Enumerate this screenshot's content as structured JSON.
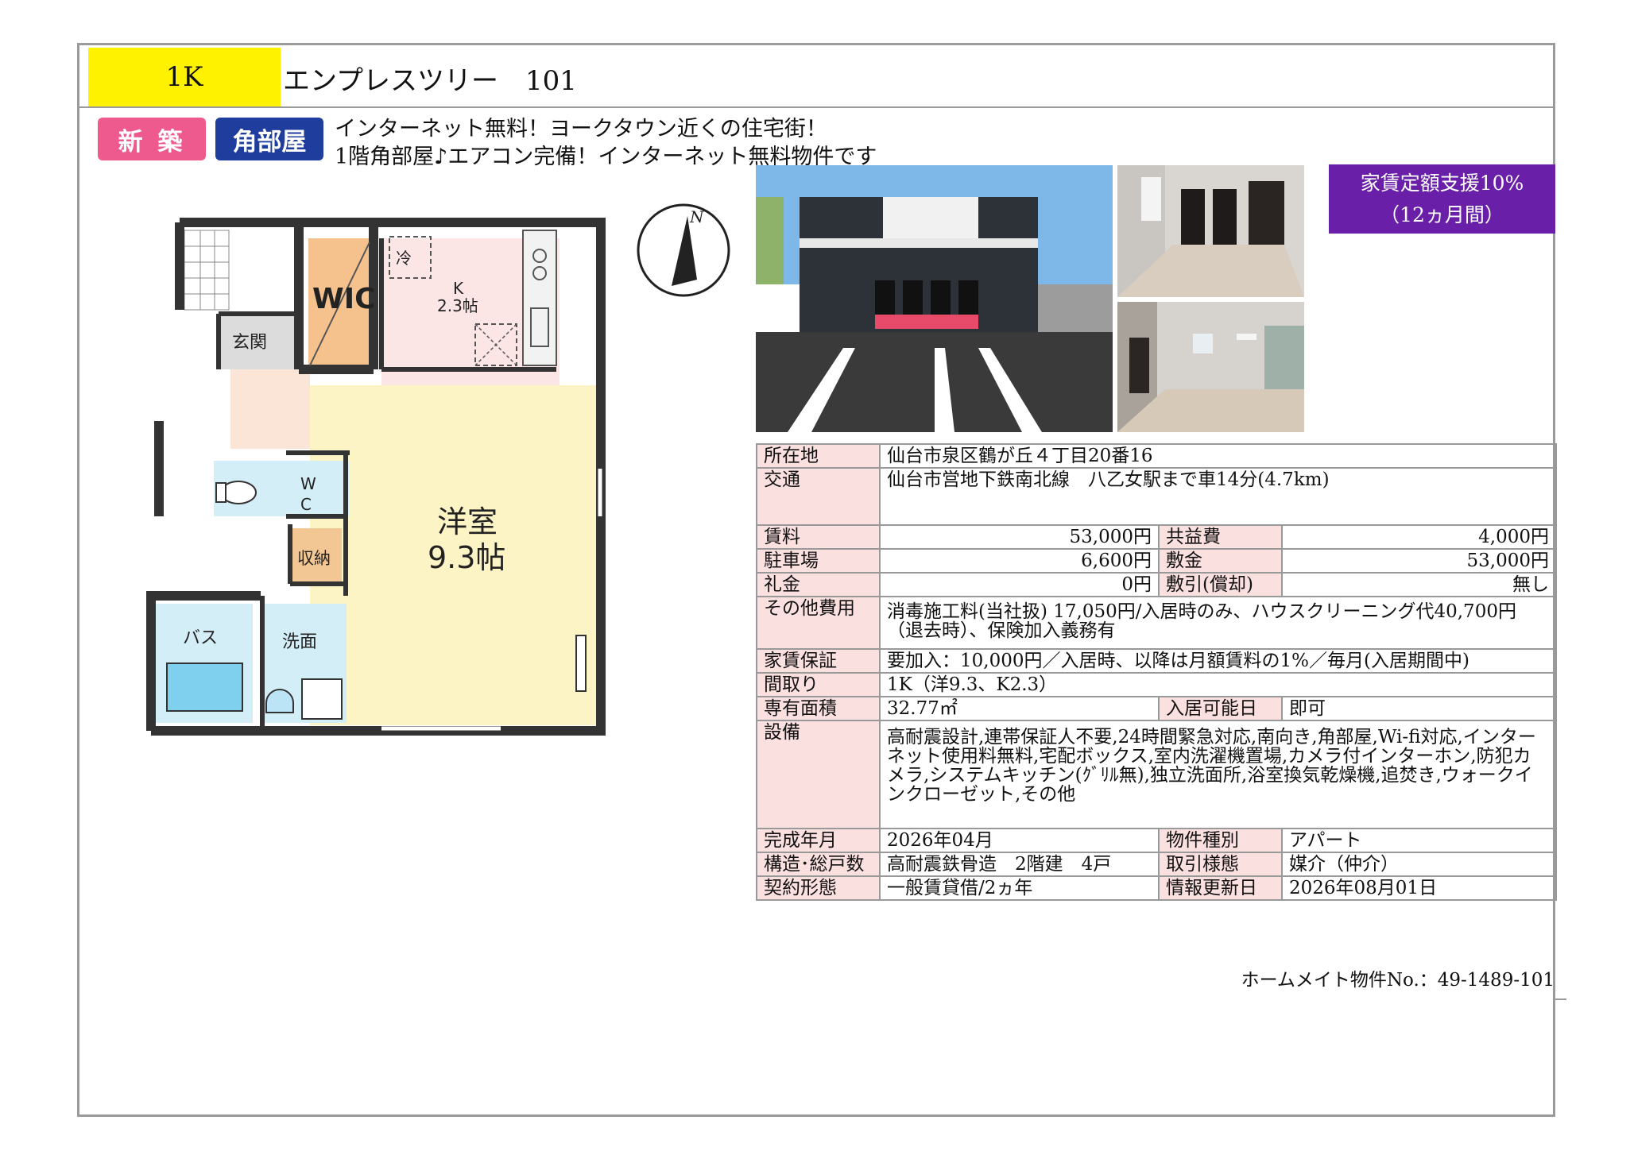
{
  "header": {
    "layout_type": "1K",
    "property_name": "エンプレスツリー　101"
  },
  "badges": {
    "new": "新 築",
    "corner": "角部屋"
  },
  "catchcopy": {
    "line1": "インターネット無料！ヨークタウン近くの住宅街！",
    "line2": "1階角部屋♪エアコン完備！インターネット無料物件です"
  },
  "rent_support": {
    "line1": "家賃定額支援10%",
    "line2": "（12ヵ月間）"
  },
  "floorplan": {
    "wic": "WIC",
    "entrance": "玄関",
    "kitchen_ref": "冷",
    "kitchen_name": "K",
    "kitchen_size": "2.3帖",
    "wc_w": "W",
    "wc_c": "C",
    "storage": "収納",
    "room_name": "洋室",
    "room_size": "9.3帖",
    "bath": "バス",
    "washroom": "洗面",
    "north": "N"
  },
  "specs": {
    "address_label": "所在地",
    "address": "仙台市泉区鶴が丘４丁目20番16",
    "transport_label": "交通",
    "transport": "仙台市営地下鉄南北線　八乙女駅まで車14分(4.7km)",
    "rent_label": "賃料",
    "rent": "53,000円",
    "common_label": "共益費",
    "common": "4,000円",
    "parking_label": "駐車場",
    "parking": "6,600円",
    "deposit_label": "敷金",
    "deposit": "53,000円",
    "key_money_label": "礼金",
    "key_money": "0円",
    "amortization_label": "敷引(償却)",
    "amortization": "無し",
    "other_label": "その他費用",
    "other": "消毒施工料(当社扱) 17,050円/入居時のみ、ハウスクリーニング代40,700円（退去時）、保険加入義務有",
    "guarantee_label": "家賃保証",
    "guarantee": "要加入：10,000円／入居時、以降は月額賃料の1%／毎月(入居期間中)",
    "layout_label": "間取り",
    "layout": "1K（洋9.3、K2.3）",
    "area_label": "専有面積",
    "area": "32.77㎡",
    "move_in_label": "入居可能日",
    "move_in": "即可",
    "facilities_label": "設備",
    "facilities": "高耐震設計,連帯保証人不要,24時間緊急対応,南向き,角部屋,Wi-fi対応,インターネット使用料無料,宅配ボックス,室内洗濯機置場,カメラ付インターホン,防犯カメラ,システムキッチン(ｸﾞﾘﾙ無),独立洗面所,浴室換気乾燥機,追焚き,ウォークインクローゼット,その他",
    "built_label": "完成年月",
    "built": "2026年04月",
    "kind_label": "物件種別",
    "kind": "アパート",
    "structure_label": "構造･総戸数",
    "structure": "高耐震鉄骨造　2階建　4戸",
    "deal_label": "取引様態",
    "deal": "媒介（仲介）",
    "contract_label": "契約形態",
    "contract": "一般賃貸借/2ヵ年",
    "updated_label": "情報更新日",
    "updated": "2026年08月01日"
  },
  "property_number": "ホームメイト物件No.：49-1489-101",
  "colors": {
    "type_box": "#fff200",
    "badge_new": "#ee5a8d",
    "badge_corner": "#1f3d9c",
    "support": "#6a1fa8",
    "label_cell": "#fbe0e0"
  }
}
